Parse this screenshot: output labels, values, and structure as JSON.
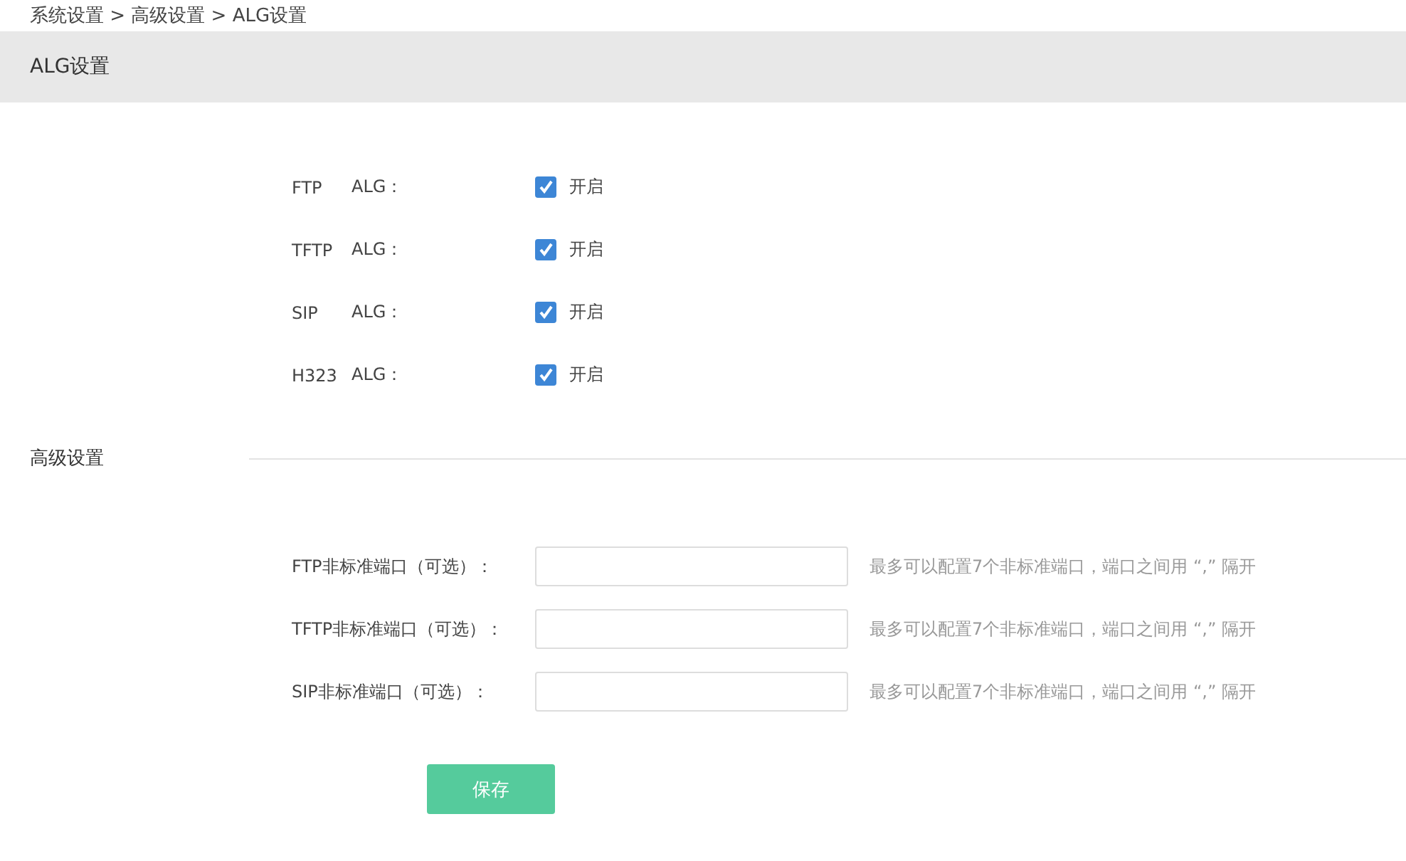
{
  "breadcrumb": "系统设置 > 高级设置 > ALG设置",
  "header": {
    "title": "ALG设置"
  },
  "alg_options": [
    {
      "protocol": "FTP",
      "suffix": "ALG：",
      "checked": true,
      "label": "开启"
    },
    {
      "protocol": "TFTP",
      "suffix": "ALG：",
      "checked": true,
      "label": "开启"
    },
    {
      "protocol": "SIP",
      "suffix": "ALG：",
      "checked": true,
      "label": "开启"
    },
    {
      "protocol": "H323",
      "suffix": "ALG：",
      "checked": true,
      "label": "开启"
    }
  ],
  "advanced": {
    "title": "高级设置",
    "fields": [
      {
        "label": "FTP非标准端口（可选）：",
        "hint": "最多可以配置7个非标准端口，端口之间用 “,” 隔开"
      },
      {
        "label": "TFTP非标准端口（可选）：",
        "hint": "最多可以配置7个非标准端口，端口之间用 “,” 隔开"
      },
      {
        "label": "SIP非标准端口（可选）：",
        "hint": "最多可以配置7个非标准端口，端口之间用 “,” 隔开"
      }
    ]
  },
  "save_button": "保存"
}
